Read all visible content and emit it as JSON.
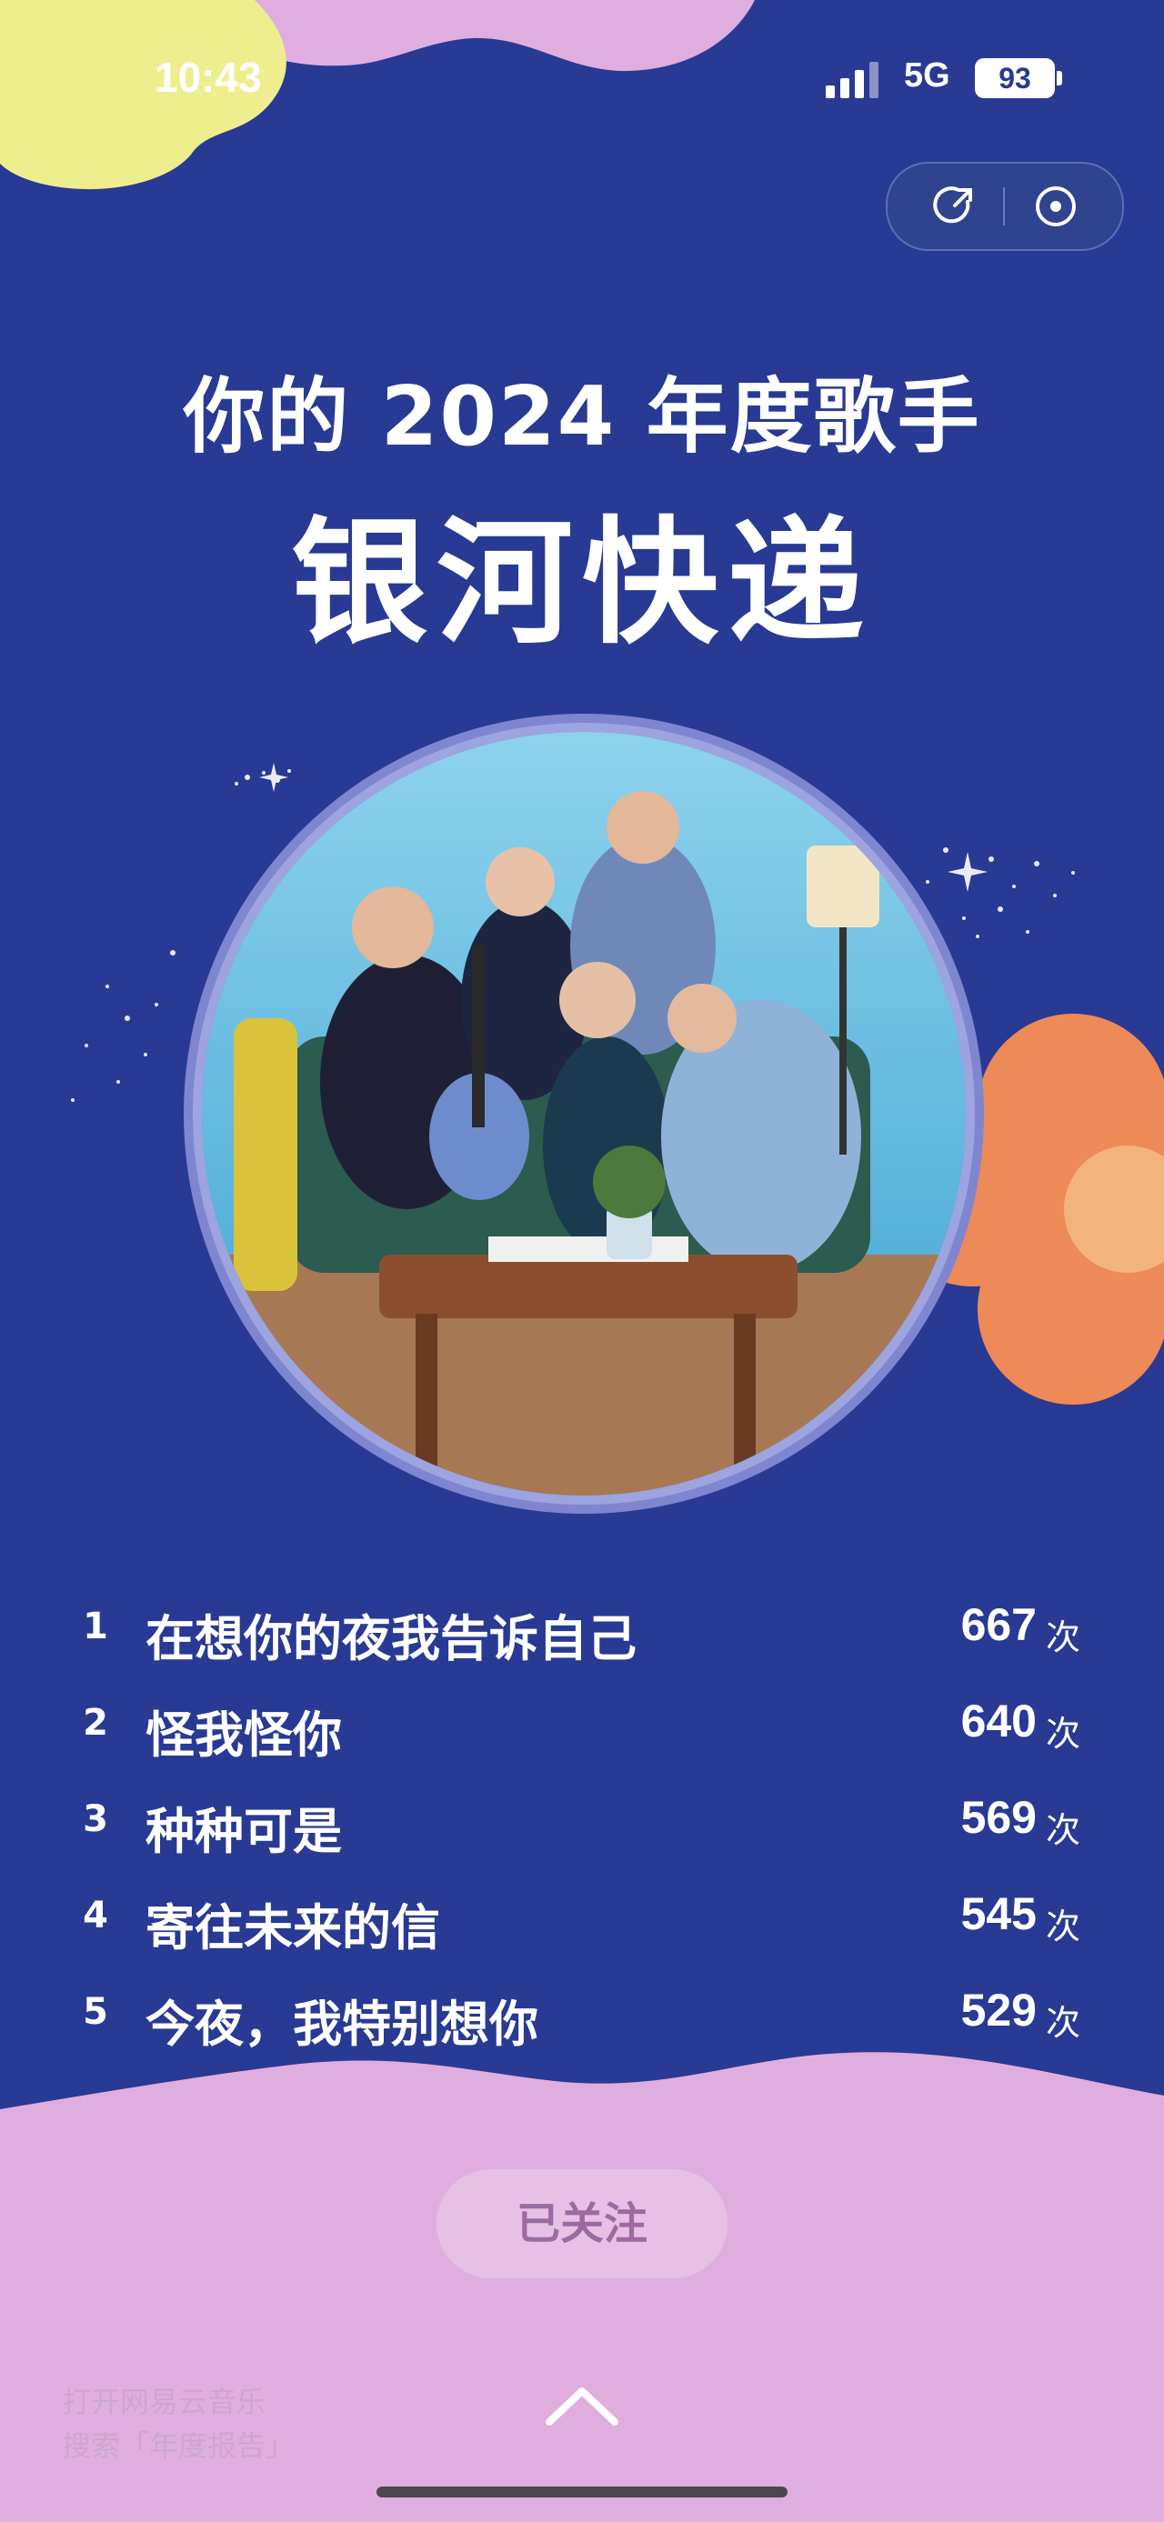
{
  "status_bar": {
    "time": "10:43",
    "network": "5G",
    "battery": "93"
  },
  "header": {
    "title_line1": "你的 2024 年度歌手",
    "artist_name": "银河快递"
  },
  "top_songs": [
    {
      "rank": "1",
      "title": "在想你的夜我告诉自己",
      "count": "667",
      "unit": "次"
    },
    {
      "rank": "2",
      "title": "怪我怪你",
      "count": "640",
      "unit": "次"
    },
    {
      "rank": "3",
      "title": "种种可是",
      "count": "569",
      "unit": "次"
    },
    {
      "rank": "4",
      "title": "寄往未来的信",
      "count": "545",
      "unit": "次"
    },
    {
      "rank": "5",
      "title": "今夜，我特别想你",
      "count": "529",
      "unit": "次"
    }
  ],
  "follow_button": {
    "label": "已关注"
  },
  "footer": {
    "line1": "打开网易云音乐",
    "line2": "搜索「年度报告」"
  },
  "icons": {
    "share": "share-icon",
    "close": "close-icon",
    "expand": "chevron-up-icon"
  },
  "colors": {
    "background": "#283a94",
    "pink_wave": "#dfaede",
    "yellow_blob": "#efee8e",
    "orange_flower": "#ee8a57",
    "accent_text": "#ffffff"
  }
}
